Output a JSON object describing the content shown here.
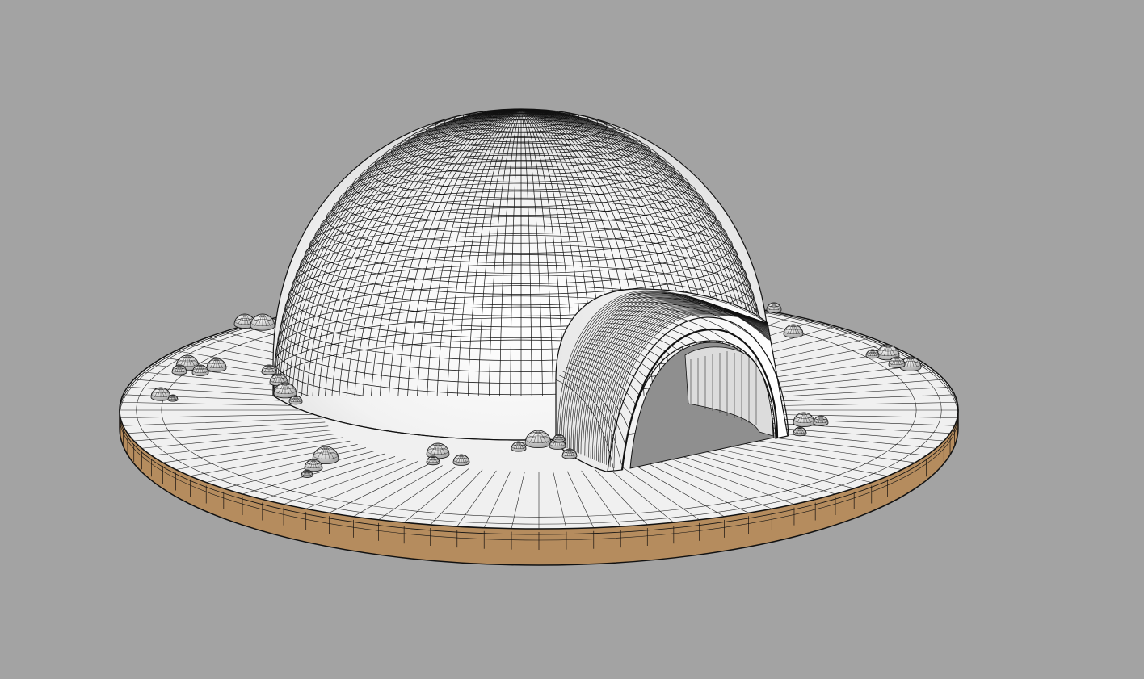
{
  "viewport": {
    "background_color": "#a3a3a3",
    "view": "perspective",
    "display_mode": "shaded-wireframe"
  },
  "model": {
    "subject": "igloo",
    "colors": {
      "surface": "#ffffff",
      "surface_shade": "#d9d9d9",
      "wire": "#111111",
      "base_side": "#b58c5e",
      "base_side_dark": "#8a6a45",
      "tunnel_inner": "#bdbdbd"
    }
  }
}
